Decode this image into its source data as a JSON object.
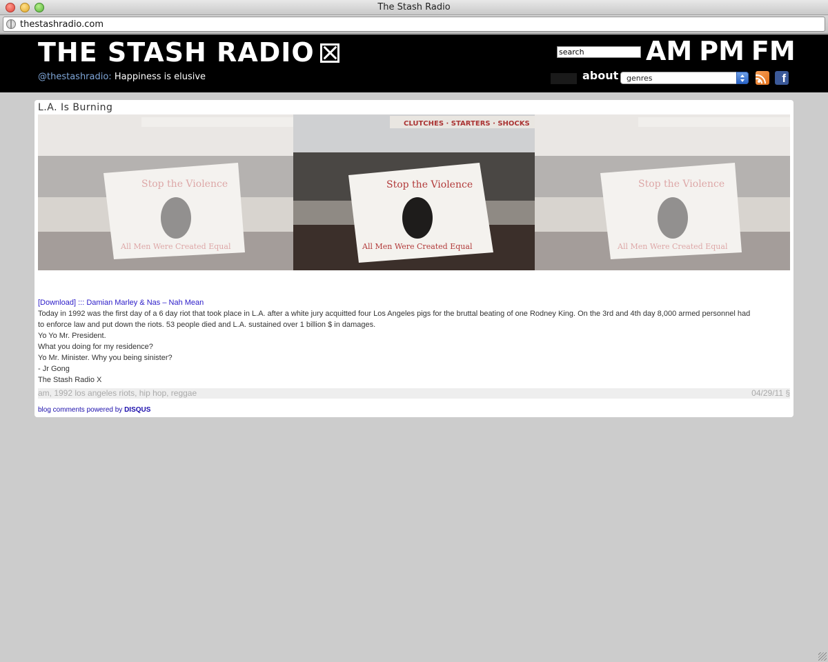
{
  "window": {
    "title": "The Stash Radio",
    "url": "thestashradio.com"
  },
  "header": {
    "logo_text": "THE STASH RADIO",
    "handle": "@thestashradio:",
    "tagline": "Happiness is elusive",
    "search_placeholder": "search",
    "nav_am": "AM",
    "nav_pm": "PM",
    "nav_fm": "FM",
    "about_label": "about",
    "genres_selected": "genres"
  },
  "post": {
    "title": "L.A. Is Burning",
    "photo_banner_text": "CLUTCHES · STARTERS · SHOCKS",
    "photo_sheet_line1": "Stop the Violence",
    "photo_sheet_line2": "All Men Were Created Equal",
    "download_link": "[Download] ::: Damian Marley & Nas – Nah Mean",
    "body_lines": [
      "Today in 1992 was the first day of a 6 day riot that took place in L.A. after a white jury acquitted four Los Angeles pigs for the bruttal beating of one Rodney King. On the 3rd and 4th day 8,000 armed personnel had to enforce law and put down the riots. 53 people died and L.A. sustained over 1 billion $ in damages.",
      "Yo Yo Mr. President.",
      "What you doing for my residence?",
      "Yo Mr. Minister. Why you being sinister?",
      "- Jr Gong",
      "The Stash Radio X"
    ],
    "tags": "am, 1992 los angeles riots, hip hop, reggae",
    "date": "04/29/11 §",
    "disqus_prefix": "blog comments powered by",
    "disqus_brand": "DISQUS"
  },
  "colors": {
    "header_bg": "#000000",
    "page_bg": "#cccccc",
    "link": "#1a0dab",
    "handle": "#7fa6d8"
  }
}
